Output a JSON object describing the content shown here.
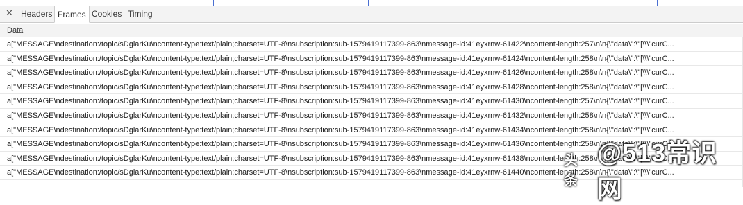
{
  "tabs": [
    {
      "label": "Headers",
      "active": false
    },
    {
      "label": "Frames",
      "active": true
    },
    {
      "label": "Cookies",
      "active": false
    },
    {
      "label": "Timing",
      "active": false
    }
  ],
  "close_icon": "close-icon",
  "column_header": "Data",
  "rows": [
    "a[\"MESSAGE\\ndestination:/topic/sDglarKu\\ncontent-type:text/plain;charset=UTF-8\\nsubscription:sub-1579419117399-863\\nmessage-id:41eyxrnw-61422\\ncontent-length:257\\n\\n{\\\"data\\\":\\\"[\\\\\\\"curC...",
    "a[\"MESSAGE\\ndestination:/topic/sDglarKu\\ncontent-type:text/plain;charset=UTF-8\\nsubscription:sub-1579419117399-863\\nmessage-id:41eyxrnw-61424\\ncontent-length:258\\n\\n{\\\"data\\\":\\\"[\\\\\\\"curC...",
    "a[\"MESSAGE\\ndestination:/topic/sDglarKu\\ncontent-type:text/plain;charset=UTF-8\\nsubscription:sub-1579419117399-863\\nmessage-id:41eyxrnw-61426\\ncontent-length:258\\n\\n{\\\"data\\\":\\\"[\\\\\\\"curC...",
    "a[\"MESSAGE\\ndestination:/topic/sDglarKu\\ncontent-type:text/plain;charset=UTF-8\\nsubscription:sub-1579419117399-863\\nmessage-id:41eyxrnw-61428\\ncontent-length:258\\n\\n{\\\"data\\\":\\\"[\\\\\\\"curC...",
    "a[\"MESSAGE\\ndestination:/topic/sDglarKu\\ncontent-type:text/plain;charset=UTF-8\\nsubscription:sub-1579419117399-863\\nmessage-id:41eyxrnw-61430\\ncontent-length:257\\n\\n{\\\"data\\\":\\\"[\\\\\\\"curC...",
    "a[\"MESSAGE\\ndestination:/topic/sDglarKu\\ncontent-type:text/plain;charset=UTF-8\\nsubscription:sub-1579419117399-863\\nmessage-id:41eyxrnw-61432\\ncontent-length:258\\n\\n{\\\"data\\\":\\\"[\\\\\\\"curC...",
    "a[\"MESSAGE\\ndestination:/topic/sDglarKu\\ncontent-type:text/plain;charset=UTF-8\\nsubscription:sub-1579419117399-863\\nmessage-id:41eyxrnw-61434\\ncontent-length:258\\n\\n{\\\"data\\\":\\\"[\\\\\\\"curC...",
    "a[\"MESSAGE\\ndestination:/topic/sDglarKu\\ncontent-type:text/plain;charset=UTF-8\\nsubscription:sub-1579419117399-863\\nmessage-id:41eyxrnw-61436\\ncontent-length:258\\n\\n{\\\"data\\\":\\\"[\\\\\\\"curC...",
    "a[\"MESSAGE\\ndestination:/topic/sDglarKu\\ncontent-type:text/plain;charset=UTF-8\\nsubscription:sub-1579419117399-863\\nmessage-id:41eyxrnw-61438\\ncontent-length:258\\n\\n{\\\"data\\\":\\\"[\\\\\\\"curC...",
    "a[\"MESSAGE\\ndestination:/topic/sDglarKu\\ncontent-type:text/plain;charset=UTF-8\\nsubscription:sub-1579419117399-863\\nmessage-id:41eyxrnw-61440\\ncontent-length:258\\n\\n{\\\"data\\\":\\\"[\\\\\\\"curC..."
  ],
  "watermark": {
    "brand": "头条",
    "site": "@513常识网"
  },
  "colors": {
    "tab_bar_bg": "#f3f3f3",
    "row_border": "#e8e8e8",
    "accent_strip_blue": "#4a6fd1",
    "accent_strip_orange": "#f0a030"
  }
}
